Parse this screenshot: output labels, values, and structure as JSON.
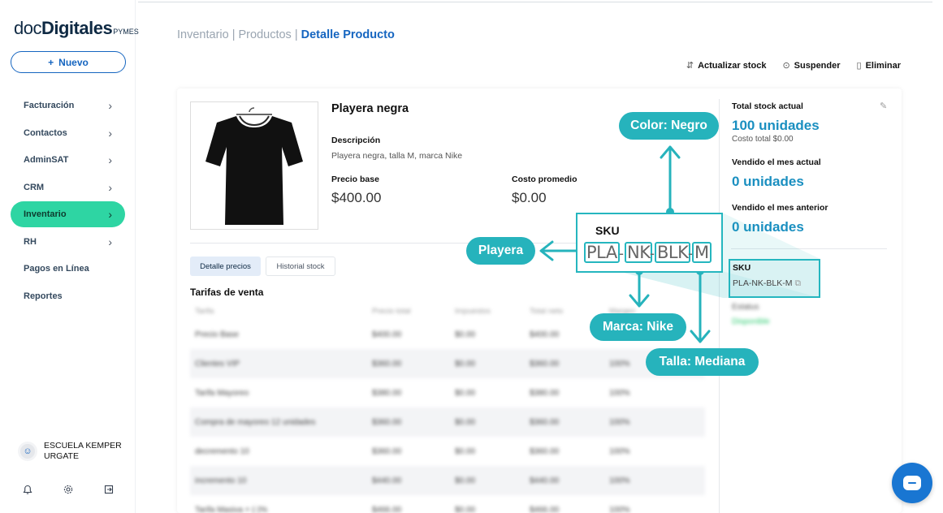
{
  "logo": {
    "doc": "doc",
    "digitales": "Digitales",
    "pymes": "PYMES"
  },
  "sidebar": {
    "new_button": "Nuevo",
    "items": [
      {
        "label": "Facturación",
        "chevron": true
      },
      {
        "label": "Contactos",
        "chevron": true
      },
      {
        "label": "AdminSAT",
        "chevron": true
      },
      {
        "label": "CRM",
        "chevron": true
      },
      {
        "label": "Inventario",
        "chevron": true,
        "active": true
      },
      {
        "label": "RH",
        "chevron": true
      },
      {
        "label": "Pagos en Línea",
        "chevron": false
      },
      {
        "label": "Reportes",
        "chevron": false
      }
    ],
    "user_line1": "ESCUELA KEMPER",
    "user_line2": "URGATE"
  },
  "breadcrumb": {
    "part1": "Inventario",
    "sep1": " | ",
    "part2": "Productos",
    "sep2": " | ",
    "current": "Detalle Producto"
  },
  "actions": {
    "update_stock": "Actualizar stock",
    "suspend": "Suspender",
    "delete": "Eliminar"
  },
  "product": {
    "name": "Playera negra",
    "description_label": "Descripción",
    "description": "Playera negra, talla M, marca Nike",
    "base_price_label": "Precio base",
    "base_price": "$400.00",
    "avg_cost_label": "Costo promedio",
    "avg_cost": "$0.00"
  },
  "tabs": {
    "prices": "Detalle precios",
    "stock_history": "Historial stock"
  },
  "tariffs": {
    "title": "Tarifas de venta",
    "headers": [
      "Tarifa",
      "Precio total",
      "Impuestos",
      "Total neto",
      "Margen"
    ],
    "rows": [
      [
        "Precio Base",
        "$400.00",
        "$0.00",
        "$400.00",
        "100%"
      ],
      [
        "Clientes VIP",
        "$360.00",
        "$0.00",
        "$360.00",
        "100%"
      ],
      [
        "Tarifa Mayoreo",
        "$380.00",
        "$0.00",
        "$380.00",
        "100%"
      ],
      [
        "Compra de mayoreo 12 unidades",
        "$360.00",
        "$0.00",
        "$360.00",
        "100%"
      ],
      [
        "decremento 10",
        "$360.00",
        "$0.00",
        "$360.00",
        "100%"
      ],
      [
        "incremento 10",
        "$440.00",
        "$0.00",
        "$440.00",
        "100%"
      ],
      [
        "Tarifa Masiva + (-)%",
        "$466.00",
        "$0.00",
        "$466.00",
        "100%"
      ]
    ]
  },
  "stock": {
    "total_label": "Total stock actual",
    "total_value": "100 unidades",
    "total_cost": "Costo total $0.00",
    "sold_month_label": "Vendido el mes actual",
    "sold_month_value": "0 unidades",
    "sold_prev_label": "Vendido el mes anterior",
    "sold_prev_value": "0 unidades",
    "sku_label": "SKU",
    "sku_value": "PLA-NK-BLK-M",
    "status_label": "Estatus",
    "status_value": "Disponible"
  },
  "annotation": {
    "sku_title": "SKU",
    "segments": [
      "PLA",
      "NK",
      "BLK",
      "M"
    ],
    "color": "Color: Negro",
    "playera": "Playera",
    "marca": "Marca: Nike",
    "talla": "Talla: Mediana"
  },
  "colors": {
    "brand_blue": "#1565c0",
    "active_green": "#2ed5a3",
    "annotation_teal": "#26b3bc",
    "stat_blue": "#1a8fc0"
  }
}
